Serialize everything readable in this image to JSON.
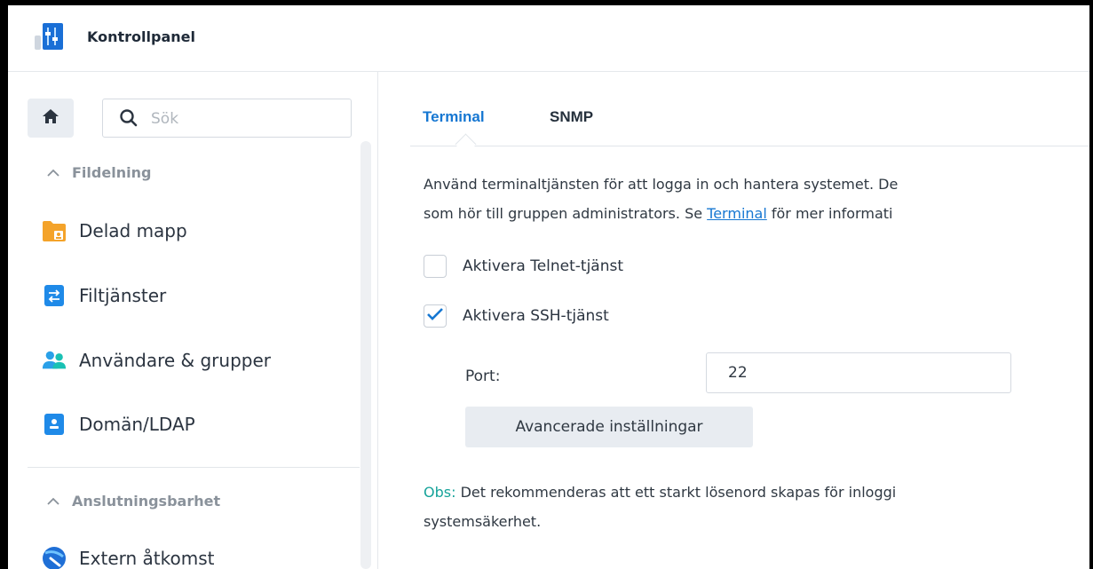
{
  "window": {
    "title": "Kontrollpanel",
    "icon": "control-panel-icon"
  },
  "sidebar": {
    "home_icon": "home-icon",
    "search": {
      "placeholder": "Sök",
      "value": ""
    },
    "sections": [
      {
        "label": "Fildelning",
        "items": [
          {
            "label": "Delad mapp",
            "icon": "shared-folder-icon"
          },
          {
            "label": "Filtjänster",
            "icon": "file-services-icon"
          },
          {
            "label": "Användare & grupper",
            "icon": "users-groups-icon"
          },
          {
            "label": "Domän/LDAP",
            "icon": "domain-ldap-icon"
          }
        ]
      },
      {
        "label": "Anslutningsbarhet",
        "items": [
          {
            "label": "Extern åtkomst",
            "icon": "external-access-icon"
          }
        ]
      }
    ]
  },
  "main": {
    "tabs": [
      {
        "label": "Terminal",
        "active": true
      },
      {
        "label": "SNMP",
        "active": false
      }
    ],
    "description": {
      "line1": "Använd terminaltjänsten för att logga in och hantera systemet. De",
      "line2_prefix": "som hör till gruppen administrators. Se ",
      "line2_link": "Terminal",
      "line2_suffix": " för mer informati"
    },
    "telnet": {
      "label": "Aktivera Telnet-tjänst",
      "checked": false
    },
    "ssh": {
      "label": "Aktivera SSH-tjänst",
      "checked": true
    },
    "port": {
      "label": "Port:",
      "value": "22"
    },
    "advanced_button": "Avancerade inställningar",
    "note": {
      "prefix": "Obs:",
      "line1": " Det rekommenderas att ett starkt lösenord skapas för inloggi",
      "line2": "systemsäkerhet."
    }
  },
  "colors": {
    "accent": "#1677d2",
    "note": "#16a39a",
    "checkmark": "#1677d2"
  }
}
